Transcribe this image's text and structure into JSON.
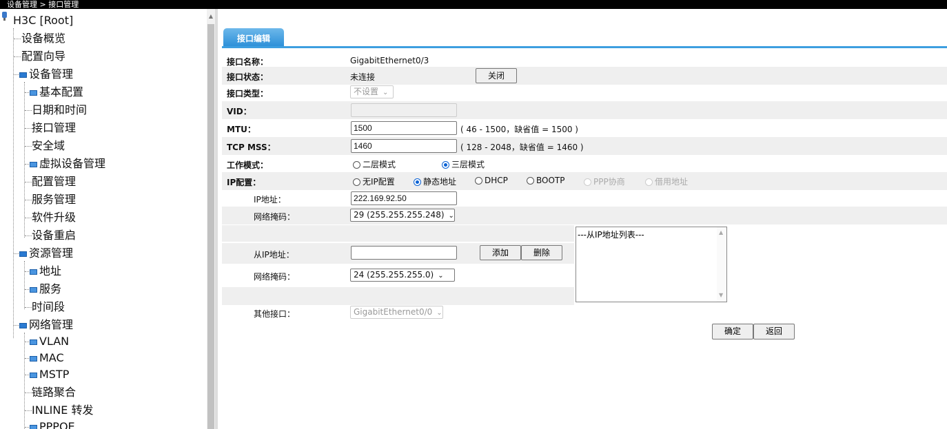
{
  "breadcrumb": "设备管理 > 接口管理",
  "sidebar": {
    "root": "H3C [Root]",
    "items": [
      {
        "label": "设备概览"
      },
      {
        "label": "配置向导"
      },
      {
        "label": "设备管理"
      },
      {
        "label": "基本配置"
      },
      {
        "label": "日期和时间"
      },
      {
        "label": "接口管理"
      },
      {
        "label": "安全域"
      },
      {
        "label": "虚拟设备管理"
      },
      {
        "label": "配置管理"
      },
      {
        "label": "服务管理"
      },
      {
        "label": "软件升级"
      },
      {
        "label": "设备重启"
      },
      {
        "label": "资源管理"
      },
      {
        "label": "地址"
      },
      {
        "label": "服务"
      },
      {
        "label": "时间段"
      },
      {
        "label": "网络管理"
      },
      {
        "label": "VLAN"
      },
      {
        "label": "MAC"
      },
      {
        "label": "MSTP"
      },
      {
        "label": "链路聚合"
      },
      {
        "label": "INLINE 转发"
      },
      {
        "label": "PPPOE"
      }
    ]
  },
  "tab": {
    "label": "接口编辑"
  },
  "form": {
    "name_label": "接口名称：",
    "name_value": "GigabitEthernet0/3",
    "status_label": "接口状态：",
    "status_value": "未连接",
    "close_button": "关闭",
    "type_label": "接口类型：",
    "type_value": "不设置",
    "vid_label": "VID：",
    "vid_value": "",
    "mtu_label": "MTU：",
    "mtu_value": "1500",
    "mtu_hint": "( 46 - 1500，缺省值 = 1500 )",
    "mss_label": "TCP MSS：",
    "mss_value": "1460",
    "mss_hint": "( 128 - 2048，缺省值 = 1460 )",
    "mode_label": "工作模式：",
    "mode_l2": "二层模式",
    "mode_l3": "三层模式",
    "ip_label": "IP配置：",
    "ip_none": "无IP配置",
    "ip_static": "静态地址",
    "ip_dhcp": "DHCP",
    "ip_bootp": "BOOTP",
    "ip_ppp": "PPP协商",
    "ip_borrow": "借用地址",
    "addr_label": "IP地址：",
    "addr_value": "222.169.92.50",
    "mask_label": "网络掩码：",
    "mask_value": "29 (255.255.255.248)",
    "sec_addr_label": "从IP地址：",
    "sec_addr_value": "",
    "add_button": "添加",
    "delete_button": "删除",
    "sec_mask_label": "网络掩码：",
    "sec_mask_value": "24 (255.255.255.0)",
    "sec_list_header": "---从IP地址列表---",
    "other_label": "其他接口：",
    "other_value": "GigabitEthernet0/0",
    "ok_button": "确定",
    "back_button": "返回"
  }
}
